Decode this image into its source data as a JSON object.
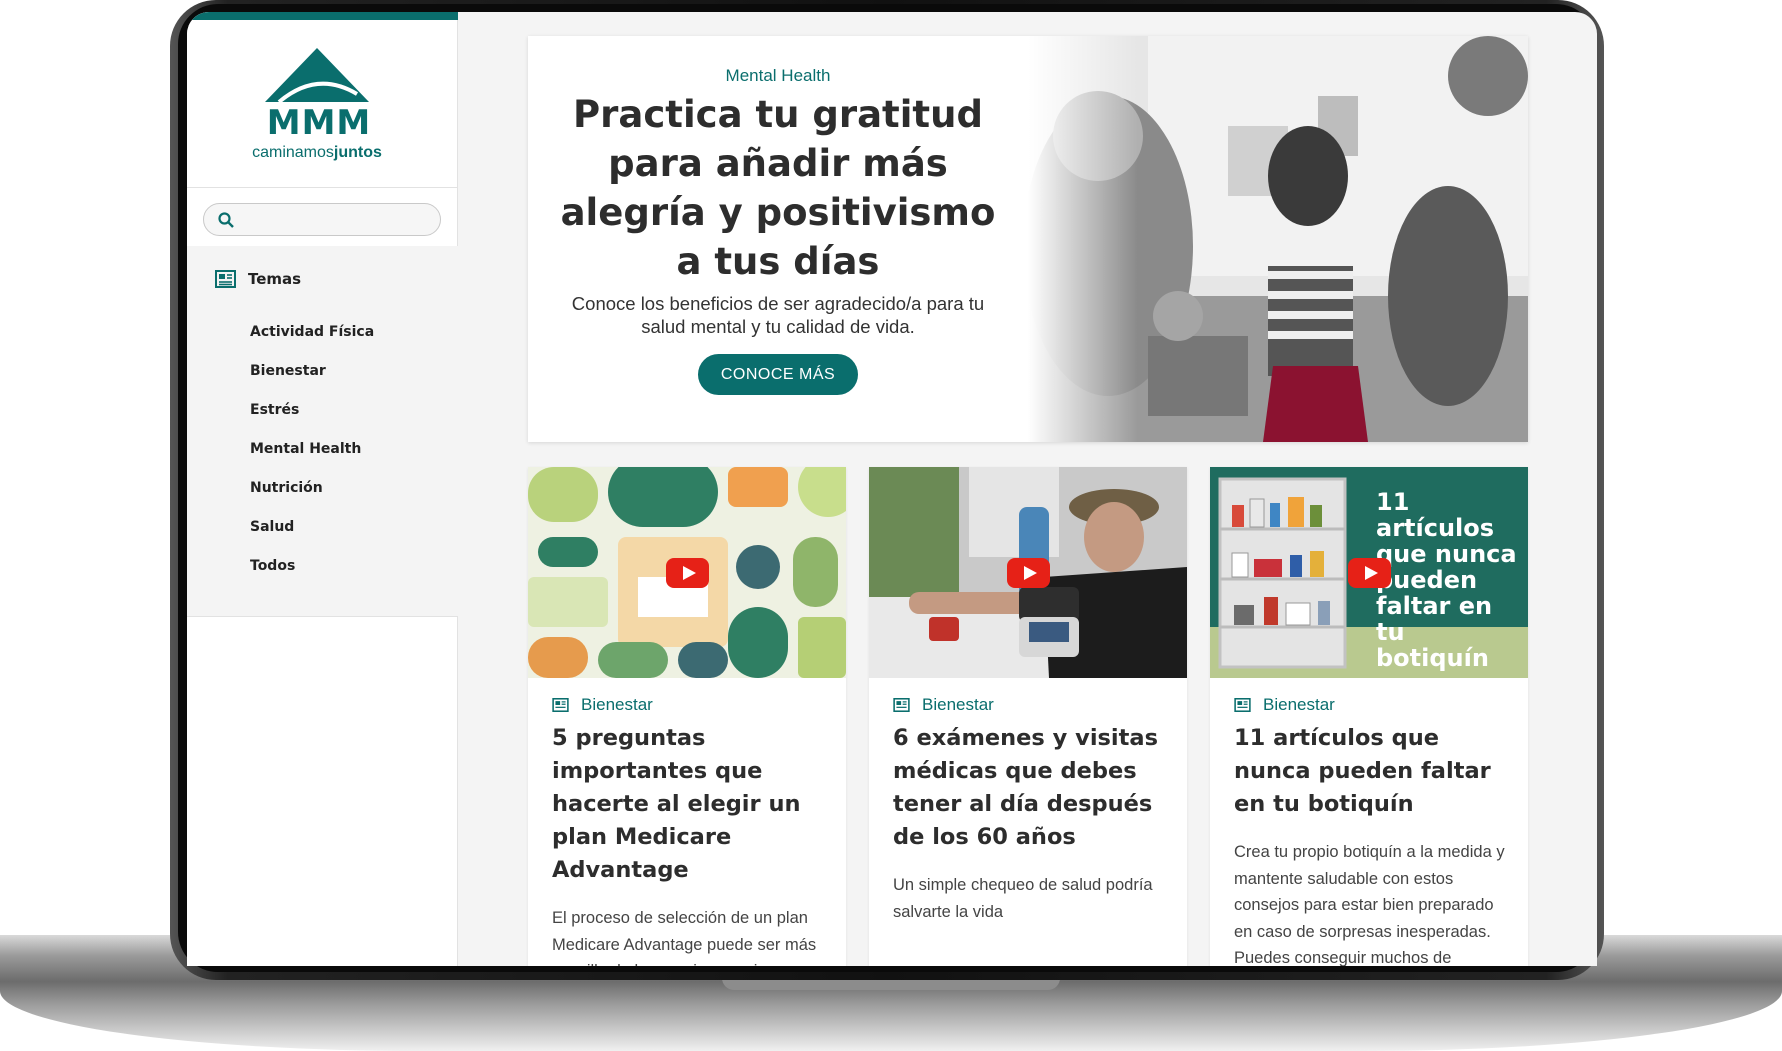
{
  "brand": {
    "logo_mark": "MMM",
    "tagline_light": "caminamos",
    "tagline_bold": "juntos",
    "accent_color": "#0a6e6d"
  },
  "search": {
    "placeholder": "",
    "value": ""
  },
  "sidebar": {
    "section_label": "Temas",
    "items": [
      {
        "label": "Actividad Física"
      },
      {
        "label": "Bienestar"
      },
      {
        "label": "Estrés"
      },
      {
        "label": "Mental Health"
      },
      {
        "label": "Nutrición"
      },
      {
        "label": "Salud"
      },
      {
        "label": "Todos"
      }
    ]
  },
  "hero": {
    "category": "Mental Health",
    "title": "Practica tu gratitud para añadir más alegría y positivismo a tus días",
    "description": "Conoce los beneficios de ser agradecido/a para tu salud mental y tu calidad de vida.",
    "button_label": "CONOCE MÁS"
  },
  "cards": [
    {
      "category": "Bienestar",
      "title": "5 preguntas importantes que hacerte al elegir un plan Medicare Advantage",
      "description": "El proceso de selección de un plan Medicare Advantage puede ser más sencillo de lo que piensas si"
    },
    {
      "category": "Bienestar",
      "title": "6 exámenes y visitas médicas que debes tener al día después de los 60 años",
      "description": "Un simple chequeo de salud podría salvarte la vida"
    },
    {
      "category": "Bienestar",
      "title": "11 artículos que nunca pueden faltar en tu botiquín",
      "description": "Crea tu propio botiquín a la medida y mantente saludable con estos consejos para estar bien preparado en caso de sorpresas inesperadas. Puedes conseguir muchos de",
      "thumbnail_text": "11 artículos que nunca pueden faltar en tu botiquín"
    }
  ]
}
